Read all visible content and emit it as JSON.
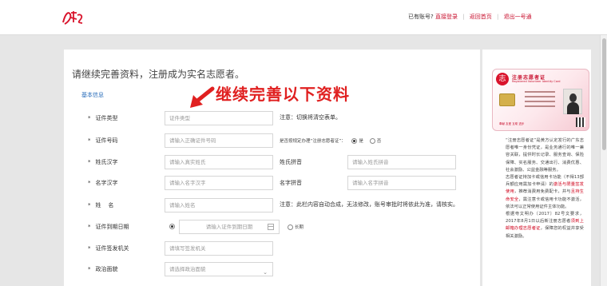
{
  "header": {
    "has_account": "已有账号?",
    "login_link": "直接登录",
    "home_link": "返回首页",
    "logout_link": "退出一号通"
  },
  "form": {
    "title": "请继续完善资料，注册成为实名志愿者。",
    "section": "基本信息",
    "annotation": "继续完善以下资料",
    "fields": {
      "id_type": {
        "label": "证件类型",
        "placeholder": "证件类型",
        "note": "注意：切换将清空表单。"
      },
      "id_number": {
        "label": "证件号码",
        "placeholder": "请输入正确证件号码",
        "card_question": "是否按规定办理“注册志愿者证”：",
        "yes": "是",
        "no": "否"
      },
      "surname": {
        "label": "姓氏汉字",
        "placeholder": "请输入真实姓氏",
        "pinyin_label": "姓氏拼音",
        "pinyin_placeholder": "请输入姓氏拼音"
      },
      "given_name": {
        "label": "名字汉字",
        "placeholder": "请输入名字汉字",
        "pinyin_label": "名字拼音",
        "pinyin_placeholder": "请输入名字拼音"
      },
      "full_name": {
        "label": "姓    名",
        "placeholder": "请输入姓名",
        "note": "注意：此栏内容自动合成，无法修改，账号审批时将依此为准，请核实。"
      },
      "expiry": {
        "label": "证件到期日期",
        "placeholder": "请输入证件到期日期",
        "long_term": "长期"
      },
      "authority": {
        "label": "证件签发机关",
        "placeholder": "请填写签发机关"
      },
      "politics": {
        "label": "政治面貌",
        "placeholder": "请选择政治面貌"
      }
    }
  },
  "card": {
    "title": "注册志愿者证",
    "subtitle": "Registered Volunteer Identity Card",
    "slogan": "奉献 友爱 互助 进步",
    "logo_char": "志"
  },
  "info": {
    "p1_a": "“注册志愿者证”是黄方认定发行的广东志愿者唯一身份凭证，是业务通行的唯一兼容关联，提供时长记录、服务查询、保险保障、实名服务、交通出行、消费优惠、社会激励、公益金融等服务。",
    "p2_a": "志愿者证持加卡或信用卡功能（不得13部兵额应用需加卡申请）的",
    "p2_red": "激活与限量签发使用",
    "p2_b": "，推荐消费用免费配卡，并与",
    "p2_red2": "且持生命安全",
    "p2_c": "，需注意卡或信用卡功能不激活，依法可以正常使用证件主体功能。",
    "p3_a": "根据粤文明办〔2017〕82号文要求，2017年8月1日以后新注册志愿者",
    "p3_red": "须到上邮箱办理志愿者证",
    "p3_b": "，保障您的权益并享受相关激励。"
  }
}
